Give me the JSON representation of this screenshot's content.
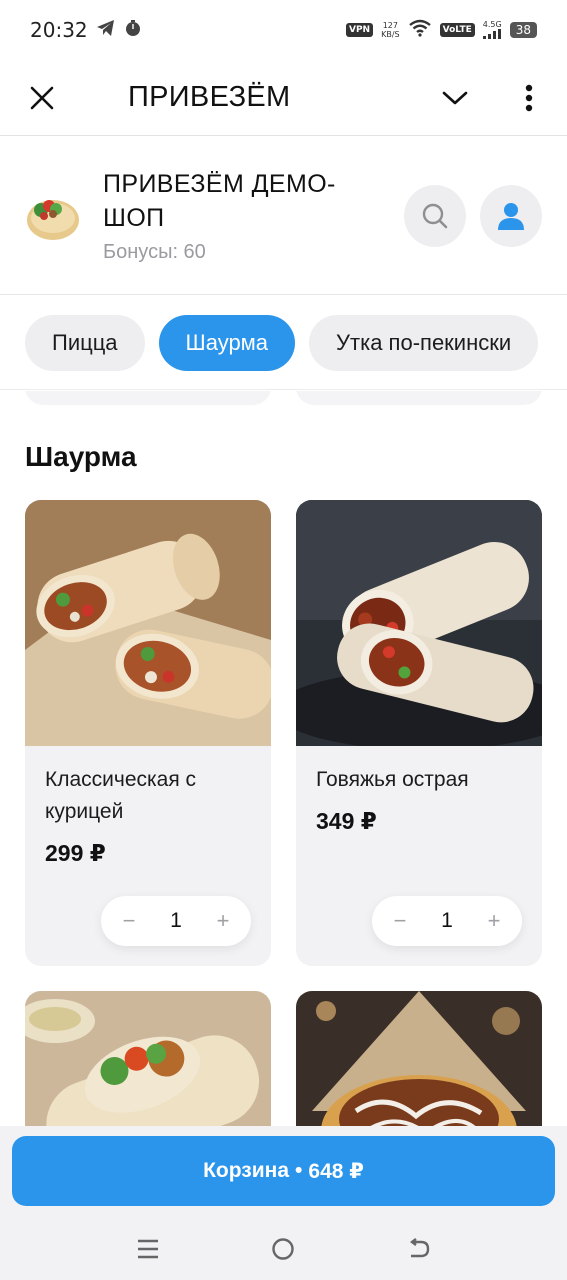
{
  "status_bar": {
    "time": "20:32",
    "vpn": "VPN",
    "speed_value": "127",
    "speed_unit": "KB/S",
    "volte": "VoLTE",
    "signal": "4.5G",
    "battery": "38"
  },
  "app_bar": {
    "title": "ПРИВЕЗЁМ",
    "close_icon": "close-icon",
    "dropdown_icon": "chevron-down-icon",
    "menu_icon": "more-vertical-icon"
  },
  "shop": {
    "name": "ПРИВЕЗЁМ ДЕМО-ШОП",
    "bonus": "Бонусы: 60",
    "search_icon": "search-icon",
    "profile_icon": "user-icon"
  },
  "categories": [
    {
      "label": "Пицца",
      "active": false
    },
    {
      "label": "Шаурма",
      "active": true
    },
    {
      "label": "Утка по-пекински",
      "active": false
    }
  ],
  "section": {
    "title": "Шаурма"
  },
  "products": [
    {
      "name": "Классическая с курицей",
      "price": "299 ₽",
      "qty": "1"
    },
    {
      "name": "Говяжья острая",
      "price": "349 ₽",
      "qty": "1"
    }
  ],
  "cart": {
    "label": "Корзина",
    "separator": "•",
    "total": "648 ₽"
  },
  "colors": {
    "accent": "#2b95ec",
    "card_bg": "#f2f2f4",
    "chip_bg": "#eeeef1"
  }
}
